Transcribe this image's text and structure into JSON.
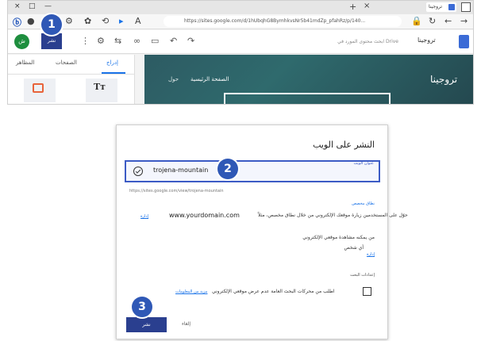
{
  "browser": {
    "tab_title": "تروجينا",
    "url": "https://sites.google.com/d/1hUbqhG8BymhkvsNr5b41mdZp_pfahRz/p/140...",
    "window_controls": [
      "×",
      "□",
      "—"
    ]
  },
  "sites_editor": {
    "avatar_initials": "ش",
    "publish_label": "نشر",
    "search_placeholder": "ابحث محتوى المورد في Drive",
    "doc_title": "تروجينا",
    "panel_tabs": {
      "insert": "إدراج",
      "pages": "الصفحات",
      "themes": "المظاهر"
    },
    "hero_title": "تروجينا",
    "hero_nav_home": "الصفحة الرئيسية",
    "hero_nav_more": "حول"
  },
  "dialog": {
    "title": "النشر على الويب",
    "address_label": "عنوان الويب",
    "address_value": "trojena-mountain",
    "url_preview": "https://sites.google.com/view/trojena-mountain",
    "custom_domain": {
      "label": "نطاق مخصص",
      "text": "حوّل على المستخدمين زيارة موقعك الإلكتروني من خلال نطاق مخصص، مثلاً",
      "example": "www.yourdomain.com",
      "manage_link": "إدارة"
    },
    "viewers": {
      "label": "من يمكنه مشاهدة موقعي الإلكتروني",
      "value": "أي شخص",
      "manage_link": "إدارة"
    },
    "search_settings": {
      "label": "إعدادات البحث",
      "text": "اطلب من محركات البحث العامة عدم عرض موقعي الإلكتروني",
      "link": "مزيد من المعلومات",
      "checked": false
    },
    "publish_label": "نشر",
    "cancel_label": "إلغاء"
  },
  "markers": [
    "1",
    "2",
    "3"
  ],
  "colors": {
    "accent": "#2f58b6",
    "publish_button": "#2a3f8f",
    "hero": "#2d5b63"
  }
}
